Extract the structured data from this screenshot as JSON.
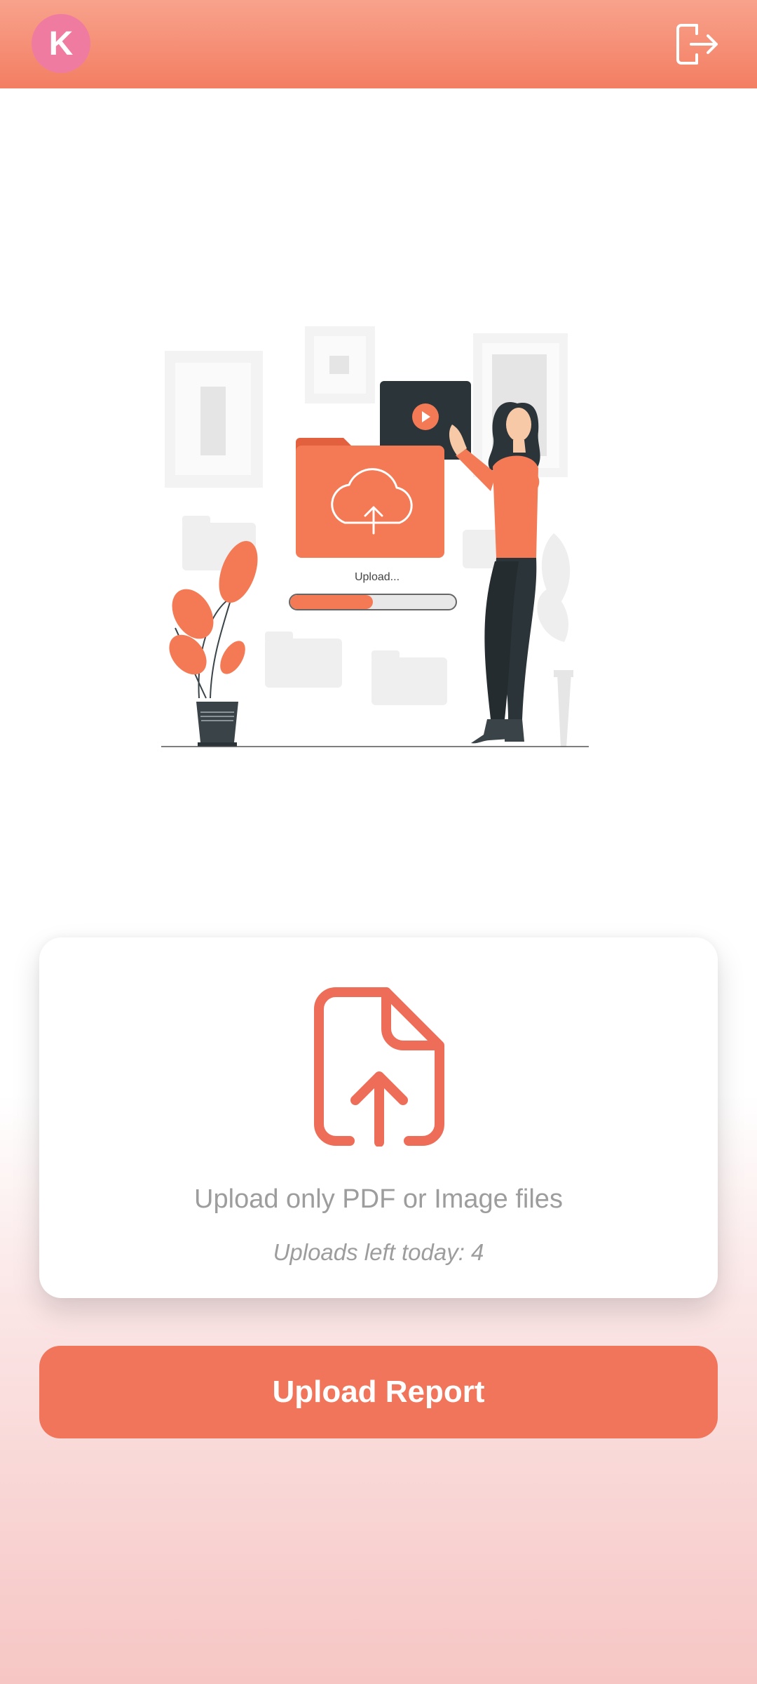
{
  "header": {
    "avatar_initial": "K",
    "logout_icon": "logout-icon"
  },
  "illustration": {
    "progress_label": "Upload...",
    "progress_fraction": 0.5
  },
  "upload_card": {
    "icon": "file-upload-icon",
    "instruction": "Upload only PDF or Image files",
    "uploads_left": "Uploads left today: 4"
  },
  "actions": {
    "upload_label": "Upload Report"
  },
  "colors": {
    "accent": "#f1755a",
    "header_top": "#f8a28c",
    "header_bottom": "#f37e62",
    "avatar": "#f07ba1"
  }
}
